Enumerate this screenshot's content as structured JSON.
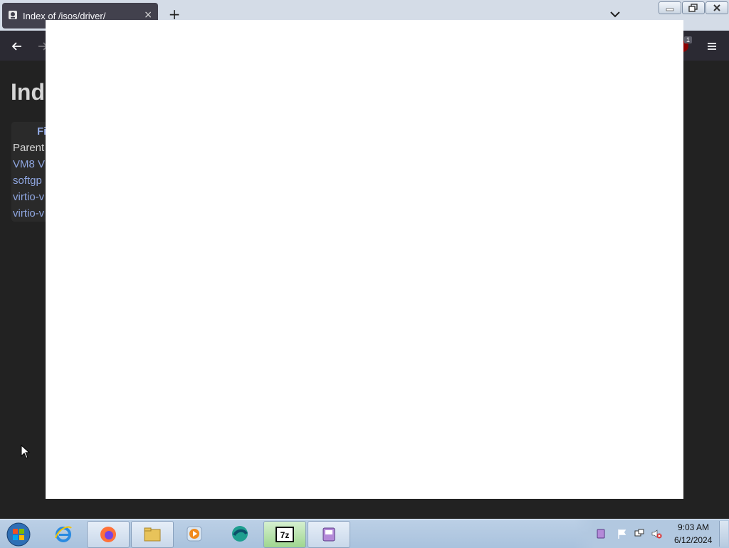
{
  "browser": {
    "tab_title": "Index of /isos/driver/",
    "tab_close": "×",
    "new_tab": "+",
    "extension_badge": "1"
  },
  "page": {
    "heading": "Ind",
    "table_header": "Fi",
    "rows": [
      {
        "text": "Parent",
        "kind": "parent"
      },
      {
        "text": "VM8 V",
        "kind": "link"
      },
      {
        "text": "softgp",
        "kind": "link"
      },
      {
        "text": "virtio-v",
        "kind": "link"
      },
      {
        "text": "virtio-v",
        "kind": "link"
      }
    ]
  },
  "taskbar": {
    "apps": [
      "internet-explorer",
      "firefox",
      "file-explorer",
      "media-player",
      "browser-alt",
      "7-zip",
      "app-window"
    ],
    "seven_zip_label": "7z",
    "clock_time": "9:03 AM",
    "clock_date": "6/12/2024"
  },
  "colors": {
    "page_bg": "#222222",
    "link": "#8fa6e0",
    "tab_bg": "#42414d",
    "overlay": "#ffffff"
  }
}
